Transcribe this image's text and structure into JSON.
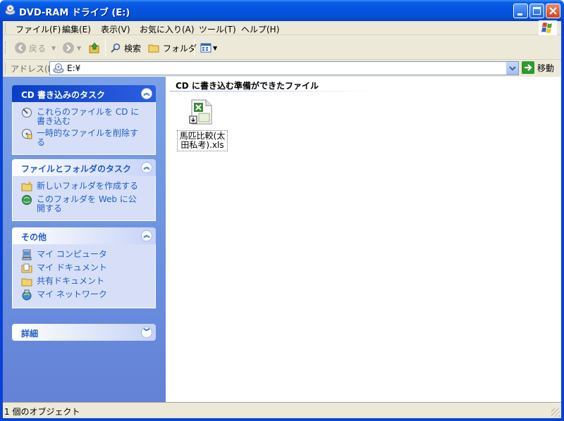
{
  "window": {
    "title": "DVD-RAM ドライブ (E:)"
  },
  "menubar": {
    "items": [
      {
        "label": "ファイル(F)"
      },
      {
        "label": "編集(E)"
      },
      {
        "label": "表示(V)"
      },
      {
        "label": "お気に入り(A)"
      },
      {
        "label": "ツール(T)"
      },
      {
        "label": "ヘルプ(H)"
      }
    ]
  },
  "toolbar": {
    "back_label": "戻る",
    "search_label": "検索",
    "folders_label": "フォルダ"
  },
  "address": {
    "label": "アドレス(D)",
    "value": "E:¥",
    "go_label": "移動"
  },
  "tasks": {
    "cd": {
      "title": "CD 書き込みのタスク",
      "items": [
        {
          "label": "これらのファイルを CD に書き込む",
          "icon": "cd-burn-icon"
        },
        {
          "label": "一時的なファイルを削除する",
          "icon": "delete-temp-files-icon"
        }
      ]
    },
    "file_folder": {
      "title": "ファイルとフォルダのタスク",
      "items": [
        {
          "label": "新しいフォルダを作成する",
          "icon": "new-folder-icon"
        },
        {
          "label": "このフォルダを Web に公開する",
          "icon": "publish-web-icon"
        }
      ]
    },
    "other": {
      "title": "その他",
      "items": [
        {
          "label": "マイ コンピュータ",
          "icon": "my-computer-icon"
        },
        {
          "label": "マイ ドキュメント",
          "icon": "my-documents-icon"
        },
        {
          "label": "共有ドキュメント",
          "icon": "shared-documents-icon"
        },
        {
          "label": "マイ ネットワーク",
          "icon": "my-network-icon"
        }
      ]
    },
    "details": {
      "title": "詳細"
    }
  },
  "content": {
    "group_header": "CD に書き込む準備ができたファイル",
    "files": [
      {
        "name": "馬匹比較(太田私考).xls",
        "icon": "excel-file-icon"
      }
    ]
  },
  "status": {
    "text": "1 個のオブジェクト"
  },
  "colors": {
    "titlebar": "#0553e0",
    "taskpane": "#6b8fdf",
    "link": "#215dc6"
  }
}
